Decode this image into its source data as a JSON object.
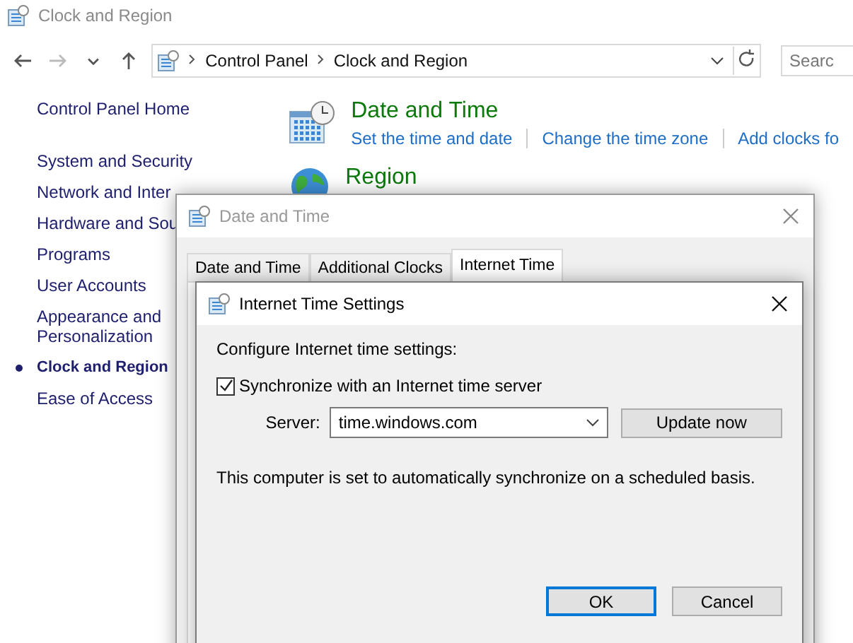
{
  "window": {
    "title": "Clock and Region"
  },
  "nav": [
    {
      "kind": "back",
      "disabled": false
    },
    {
      "kind": "forward",
      "disabled": true
    },
    {
      "kind": "recent",
      "disabled": false
    },
    {
      "kind": "up",
      "disabled": false
    }
  ],
  "address_bar": {
    "breadcrumbs": [
      "Control Panel",
      "Clock and Region"
    ]
  },
  "search": {
    "placeholder": "Searc"
  },
  "sidebar": {
    "home": "Control Panel Home",
    "items": [
      {
        "label": "System and Security",
        "selected": false
      },
      {
        "label": "Network and Inter",
        "selected": false
      },
      {
        "label": "Hardware and Sou",
        "selected": false
      },
      {
        "label": "Programs",
        "selected": false
      },
      {
        "label": "User Accounts",
        "selected": false
      },
      {
        "label": "Appearance and Personalization",
        "selected": false
      },
      {
        "label": "Clock and Region",
        "selected": true
      },
      {
        "label": "Ease of Access",
        "selected": false
      }
    ]
  },
  "categories": [
    {
      "kind": "calendar",
      "title": "Date and Time",
      "links": [
        "Set the time and date",
        "Change the time zone",
        "Add clocks fo"
      ]
    },
    {
      "kind": "globe",
      "title": "Region"
    }
  ],
  "dialog": {
    "title": "Date and Time",
    "tabs": [
      {
        "label": "Date and Time",
        "selected": false
      },
      {
        "label": "Additional Clocks",
        "selected": false
      },
      {
        "label": "Internet Time",
        "selected": true
      }
    ]
  },
  "subdialog": {
    "title": "Internet Time Settings",
    "heading": "Configure Internet time settings:",
    "sync": {
      "label": "Synchronize with an Internet time server",
      "checked": true
    },
    "server": {
      "label": "Server:",
      "value": "time.windows.com"
    },
    "update_button": "Update now",
    "status": "This computer is set to automatically synchronize on a scheduled basis.",
    "buttons": [
      {
        "label": "OK",
        "default": true
      },
      {
        "label": "Cancel",
        "default": false
      }
    ]
  }
}
